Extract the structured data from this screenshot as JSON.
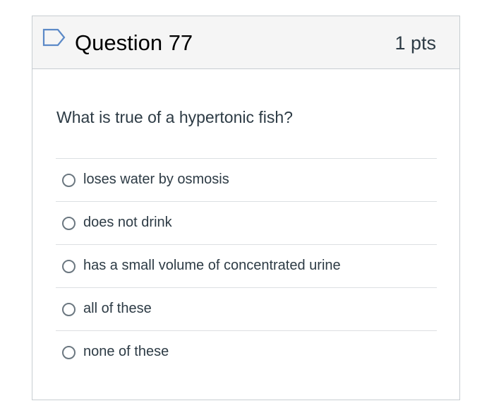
{
  "question": {
    "title": "Question 77",
    "points": "1 pts",
    "flag_icon": "bookmark-flag-icon",
    "text": "What is true of a hypertonic fish?",
    "answers": [
      {
        "label": "loses water by osmosis",
        "selected": false
      },
      {
        "label": "does not drink",
        "selected": false
      },
      {
        "label": "has a small volume of concentrated urine",
        "selected": false
      },
      {
        "label": "all of these",
        "selected": false
      },
      {
        "label": "none of these",
        "selected": false
      }
    ]
  },
  "colors": {
    "header_background": "#f5f5f5",
    "border": "#c7cdd1",
    "flag_outline": "#5b89c7",
    "text": "#2d3b45"
  }
}
